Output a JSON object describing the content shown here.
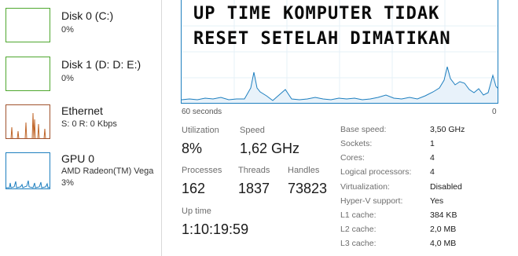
{
  "sidebar": {
    "items": [
      {
        "title": "Disk 0 (C:)",
        "line1": "0%",
        "line2": "",
        "color": "#4ea72e"
      },
      {
        "title": "Disk 1 (D: D: E:)",
        "line1": "0%",
        "line2": "",
        "color": "#4ea72e"
      },
      {
        "title": "Ethernet",
        "line1": "S: 0 R: 0 Kbps",
        "line2": "",
        "color": "#a0522d"
      },
      {
        "title": "GPU 0",
        "line1": "AMD Radeon(TM) Vega",
        "line2": "3%",
        "color": "#1e7fbf"
      }
    ]
  },
  "banner": {
    "line1": "UP TIME KOMPUTER TIDAK",
    "line2": "RESET SETELAH DIMATIKAN"
  },
  "graph": {
    "left_label": "60 seconds",
    "right_label": "0",
    "color": "#1e7fbf"
  },
  "stats": {
    "utilization": {
      "label": "Utilization",
      "value": "8%"
    },
    "speed": {
      "label": "Speed",
      "value": "1,62 GHz"
    },
    "processes": {
      "label": "Processes",
      "value": "162"
    },
    "threads": {
      "label": "Threads",
      "value": "1837"
    },
    "handles": {
      "label": "Handles",
      "value": "73823"
    },
    "uptime": {
      "label": "Up time",
      "value": "1:10:19:59"
    }
  },
  "specs": [
    {
      "key": "Base speed:",
      "value": "3,50 GHz"
    },
    {
      "key": "Sockets:",
      "value": "1"
    },
    {
      "key": "Cores:",
      "value": "4"
    },
    {
      "key": "Logical processors:",
      "value": "4"
    },
    {
      "key": "Virtualization:",
      "value": "Disabled"
    },
    {
      "key": "Hyper-V support:",
      "value": "Yes"
    },
    {
      "key": "L1 cache:",
      "value": "384 KB"
    },
    {
      "key": "L2 cache:",
      "value": "2,0 MB"
    },
    {
      "key": "L3 cache:",
      "value": "4,0 MB"
    }
  ]
}
